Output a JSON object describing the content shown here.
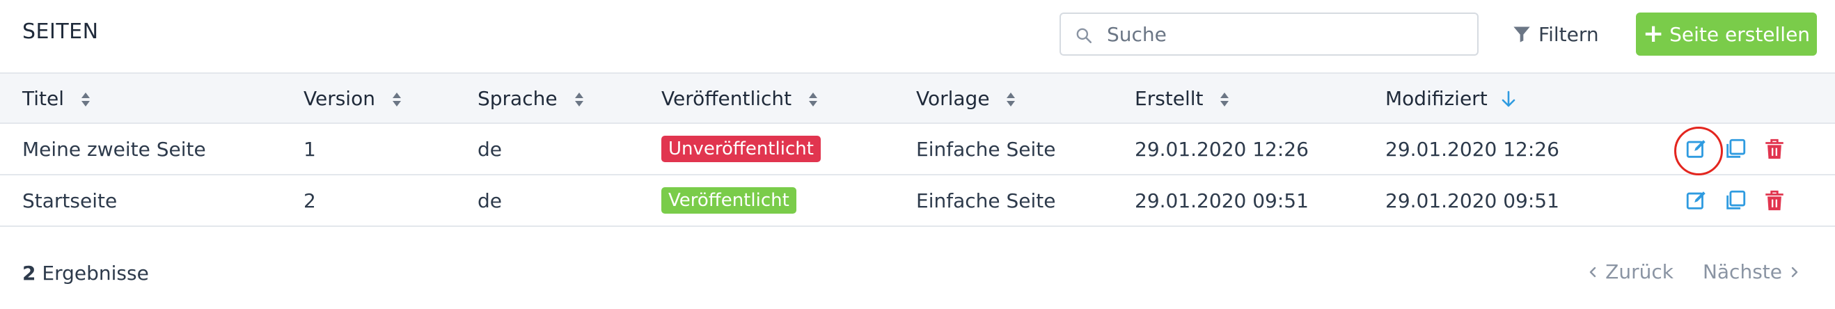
{
  "header": {
    "title": "SEITEN",
    "search_placeholder": "Suche",
    "filter_label": "Filtern",
    "create_label": "Seite erstellen"
  },
  "table": {
    "columns": [
      "Titel",
      "Version",
      "Sprache",
      "Veröffentlicht",
      "Vorlage",
      "Erstellt",
      "Modifiziert"
    ],
    "sorted_column": "Modifiziert",
    "sort_direction": "desc",
    "rows": [
      {
        "title": "Meine zweite Seite",
        "version": "1",
        "language": "de",
        "published": "Unveröffentlicht",
        "published_color": "#e1354f",
        "template": "Einfache Seite",
        "created": "29.01.2020 12:26",
        "modified": "29.01.2020 12:26"
      },
      {
        "title": "Startseite",
        "version": "2",
        "language": "de",
        "published": "Veröffentlicht",
        "published_color": "#7acc4a",
        "template": "Einfache Seite",
        "created": "29.01.2020 09:51",
        "modified": "29.01.2020 09:51"
      }
    ],
    "row_actions": [
      "edit-icon",
      "duplicate-icon",
      "trash-icon"
    ]
  },
  "footer": {
    "result_count": "2",
    "result_label": "Ergebnisse",
    "prev_label": "Zurück",
    "next_label": "Nächste"
  },
  "colors": {
    "accent_green": "#7acc4a",
    "danger_red": "#e1354f",
    "action_blue": "#2f9be0",
    "highlight_circle": "#e3261f"
  }
}
